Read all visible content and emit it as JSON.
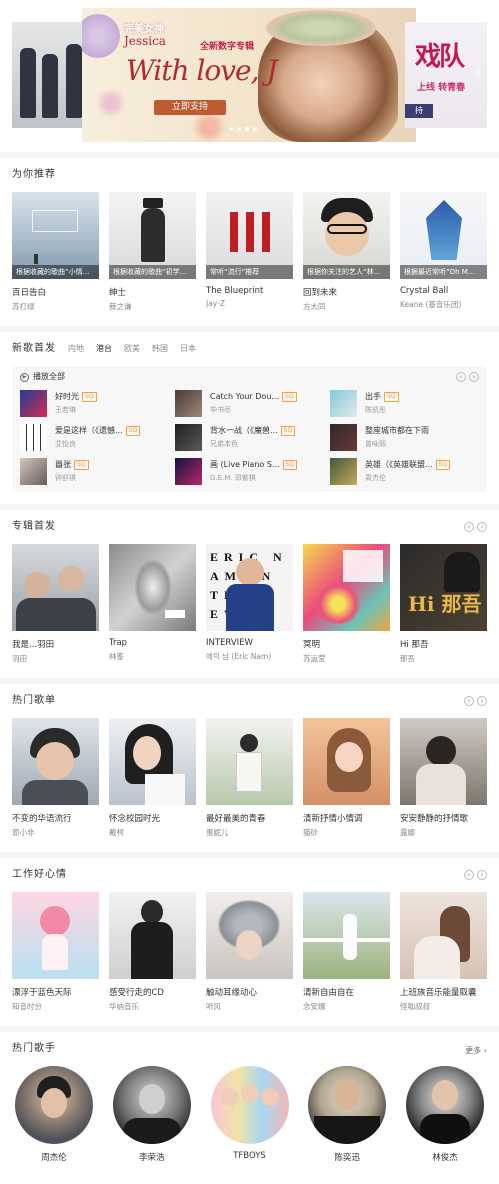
{
  "banner": {
    "main_line1": "完美女神",
    "main_name": "Jessica",
    "main_tag": "全新数字专辑",
    "main_album": "With love, J",
    "main_button": "立即支持",
    "right_big": "戏队",
    "right_small": "上线 转青春",
    "right_button": "持"
  },
  "recommend": {
    "title": "为你推荐",
    "items": [
      {
        "cover_text": "根据收藏的歌曲“小情...",
        "name": "百日告白",
        "sub": "苏打绿"
      },
      {
        "cover_text": "根据收藏的歌曲“初学...",
        "name": "绅士",
        "sub": "薛之谦"
      },
      {
        "cover_text": "常听“流行”推荐",
        "name": "The Blueprint",
        "sub": "Jay-Z"
      },
      {
        "cover_text": "根据你关注的艺人“林...",
        "name": "回到未来",
        "sub": "方大同"
      },
      {
        "cover_text": "根据最近常听“Oh M...",
        "name": "Crystal Ball",
        "sub": "Keane (基音乐团)"
      }
    ]
  },
  "newsongs": {
    "title": "新歌首发",
    "tabs": [
      "内地",
      "港台",
      "欧美",
      "韩国",
      "日本"
    ],
    "active_tab": "港台",
    "play_all": "播放全部",
    "sq_label": "SQ",
    "songs": [
      {
        "title": "好时光",
        "artist": "王若琳",
        "sq": true
      },
      {
        "title": "Catch Your Dou...",
        "artist": "毕书尽",
        "sq": true
      },
      {
        "title": "出手",
        "artist": "陈凯彤",
        "sq": true
      },
      {
        "title": "爱是这样（《遗憾...",
        "artist": "艾怡良",
        "sq": true
      },
      {
        "title": "背水一战（《魔兽...",
        "artist": "兄弟本色",
        "sq": true
      },
      {
        "title": "整座城市都在下雨",
        "artist": "曾咏熙",
        "sq": true
      },
      {
        "title": "囂张",
        "artist": "钟舒祺",
        "sq": true
      },
      {
        "title": "画 (Live Piano S...",
        "artist": "G.E.M. 邓紫棋",
        "sq": true
      },
      {
        "title": "英雄（《英雄联盟...",
        "artist": "周杰伦",
        "sq": true
      }
    ]
  },
  "albums": {
    "title": "专辑首发",
    "items": [
      {
        "name": "我是...羽田",
        "sub": "羽田"
      },
      {
        "name": "Trap",
        "sub": "林峯"
      },
      {
        "name": "INTERVIEW",
        "sub": "에릭 남 (Eric Nam)"
      },
      {
        "name": "冥明",
        "sub": "苏运莹"
      },
      {
        "name": "Hi 那吾",
        "sub": "那吾"
      }
    ],
    "cover_texts": {
      "interview": "ERIC NAM INTERVIEW",
      "hi": "Hi 那吾"
    }
  },
  "playlists": {
    "title": "热门歌单",
    "items": [
      {
        "name": "不变的华语流行",
        "sub": "郭小非"
      },
      {
        "name": "怀念校园时光",
        "sub": "戴柯"
      },
      {
        "name": "最好最美的青春",
        "sub": "蛋妮儿"
      },
      {
        "name": "清新抒情小情调",
        "sub": "猫砂"
      },
      {
        "name": "安安静静的抒情歌",
        "sub": "露娜"
      }
    ]
  },
  "work": {
    "title": "工作好心情",
    "items": [
      {
        "name": "漂浮于蓝色天际",
        "sub": "知音时分"
      },
      {
        "name": "感受行走的CD",
        "sub": "华纳音乐"
      },
      {
        "name": "触动耳缘动心",
        "sub": "听风"
      },
      {
        "name": "清新自由自在",
        "sub": "念安娜"
      },
      {
        "name": "上班族音乐能量取囊",
        "sub": "怪咖叔叔"
      }
    ]
  },
  "singers": {
    "title": "热门歌手",
    "more": "更多",
    "items": [
      {
        "name": "周杰伦"
      },
      {
        "name": "李荣浩"
      },
      {
        "name": "TFBOYS"
      },
      {
        "name": "陈奕迅"
      },
      {
        "name": "林俊杰"
      }
    ]
  },
  "pager": {
    "prev": "‹",
    "next": "›"
  },
  "colors": {
    "sq": "#f0a33d",
    "background": "#f5f5f5"
  }
}
